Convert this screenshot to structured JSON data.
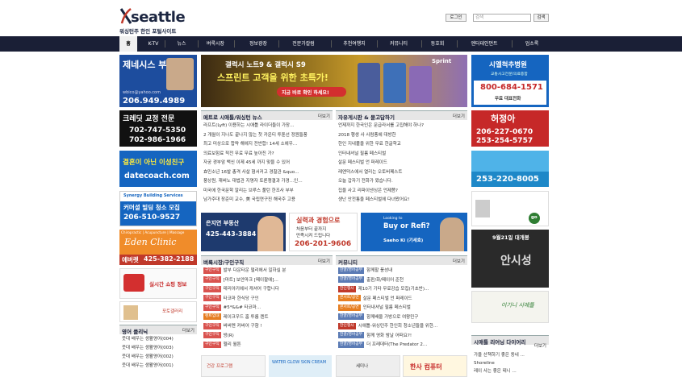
{
  "header": {
    "logo_text": "seattle",
    "logo_sub": "워싱턴주 한인 포털사이트",
    "login_label": "로그인",
    "search_placeholder": "검색",
    "search_button": "검색"
  },
  "nav": {
    "items": [
      {
        "label": "홈"
      },
      {
        "label": "K-TV"
      },
      {
        "label": "뉴스"
      },
      {
        "label": "벼룩시장"
      },
      {
        "label": "정보광장"
      },
      {
        "label": "전문가칼럼"
      },
      {
        "label": "추천여행지"
      },
      {
        "label": "커뮤니티"
      },
      {
        "label": "동호회"
      },
      {
        "label": "엔터테인먼트"
      },
      {
        "label": "업소록"
      }
    ]
  },
  "ads_left": {
    "ad1": {
      "title": "제네시스 부동산",
      "email": "wbico@yahoo.com",
      "phone": "206.949.4989"
    },
    "ad2": {
      "title": "크레딧 교정 전문",
      "phone1": "702-747-5350",
      "phone2": "702-986-1966"
    },
    "ad3": {
      "title": "결혼이 아닌 이성친구",
      "site": "datecoach.com"
    },
    "ad4": {
      "brand": "Synergy Building Services",
      "title": "커머셜 빌딩 청소 모집",
      "phone": "206-510-9527"
    },
    "ad5": {
      "tagline": "Chiropractic | Acupuncture | Massage",
      "name": "Eden Clinic",
      "label": "에버렛",
      "phone": "425-382-2188"
    },
    "ad6": {
      "text": "실시간 쇼핑 정보"
    },
    "ad7": {
      "text": "포토갤러리"
    }
  },
  "banner_main": {
    "brand": "Sprint",
    "headline1": "갤럭시 노트9 & 갤럭시 S9",
    "headline2": "스프린트 고객을 위한 초특가!",
    "cta": "지금 바로 확인 하세요!"
  },
  "ads_right": {
    "ad1": {
      "title": "시엘척추병원",
      "sub": "교통사고전문/의료종합",
      "phone": "800-684-1571",
      "note": "무료 대표전화"
    },
    "ad2": {
      "name": "허정아",
      "phone1": "206-227-0670",
      "phone2": "253-254-5757"
    },
    "ad3": {
      "phone": "253-220-8005"
    },
    "ad4": {
      "badge": "go"
    },
    "ad5": {
      "title": "9월21일 대개봉",
      "movie": "안시성"
    },
    "ad6": {
      "text": "이기니 시애틀"
    }
  },
  "mid_banners": {
    "b1": {
      "name": "은지연 부동산",
      "phone": "425-443-3884"
    },
    "b2": {
      "line1": "실력과 경험으로",
      "line2": "처음부터 끝까지",
      "line3": "만족시켜 드립니다",
      "phone": "206-201-9606"
    },
    "b3": {
      "small": "Looking to",
      "big": "Buy or Refi?",
      "name": "Saeho Ki (기세호)"
    }
  },
  "boards": {
    "news": {
      "title": "메트로 시애틀/워싱턴 뉴스",
      "more": "더보기",
      "items": [
        "라프트(Lyft) 이용하는 시애틀 라이더들이 가장…",
        "2 개월이 지나도 끝나지 않는 첫 카운티 투툰선 정원들풍",
        "최고 미상으로 합략 해에지 전반합! 14세 소에우…",
        "의료보험료 적전 무료 무료 높아진 가?",
        "자궁 경부암 백신 이제 45세 까지 맞을 수 있어",
        "효민소년 16발 총격 사살 혐서커고 경찰관 &quo…",
        "풍상원, 재버노 대법관 지명자 토론쟁결과 가경…인…",
        "미국에 한국문학 알리는 브루스 풀턴 한조사 부부",
        "남가주대 장준미 교수, 美 국립연구진 해국주 고용"
      ]
    },
    "free": {
      "title": "자유게시판 & 묻고답하기",
      "more": "더보기",
      "items": [
        "언제까지 한국인은 문급라서를 고집해야 하나?",
        "2018 행생 사 사람풍에 대방한",
        "한인 지내풀을 위한 무료 한글학교",
        "인터내셔널 필름 페스티벌",
        "살문 페스티벌 언 퍼레이드",
        "레엔덕스에서 열리는 오토버페스트",
        "오늘 갑자기 전화가 왔습니다.",
        "집을 사고 리파이낸싱은 언제쯤?",
        "생난 안전통을 페스티벌에 다녀왔어요!"
      ]
    },
    "flea": {
      "title": "벼룩시장/구인구직",
      "more": "더보기",
      "items": [
        {
          "tag": "구인구직",
          "color": "#d9534f",
          "text": "발부 다운타운 델리에서 일하실 분"
        },
        {
          "tag": "구인구직",
          "color": "#d9534f",
          "text": "[마트] 보안마크 [페이팔에]…"
        },
        {
          "tag": "구인구직",
          "color": "#d9534f",
          "text": "테리야키에서 캐셔어 구합니다"
        },
        {
          "tag": "구인구직",
          "color": "#d9534f",
          "text": "타코마 한식당 구인"
        },
        {
          "tag": "구인구직",
          "color": "#d9534f",
          "text": "#5*&&# 타코마…"
        },
        {
          "tag": "렌트임대",
          "color": "#e67e22",
          "text": "레이크우드 홈 투룸 렌트"
        },
        {
          "tag": "구인구직",
          "color": "#d9534f",
          "text": "버버멘 커버어 구함 !"
        },
        {
          "tag": "구인구직",
          "color": "#d9534f",
          "text": "방(R)"
        },
        {
          "tag": "구인구직",
          "color": "#d9534f",
          "text": "헬리 월튼"
        }
      ]
    },
    "community": {
      "title": "커뮤니티",
      "more": "더보기",
      "items": [
        {
          "tag": "한글/영어공부",
          "color": "#5b7bb5",
          "text": "함께할 풍성내"
        },
        {
          "tag": "한글/영어공부",
          "color": "#5b7bb5",
          "text": "출판/화/페이어 준천"
        },
        {
          "tag": "한인행사",
          "color": "#c0392b",
          "text": "제10기 기타 무료강습 모집(기초반)…"
        },
        {
          "tag": "콘서트/공연",
          "color": "#e67e22",
          "text": "살문 페스티벌 언 퍼레이드"
        },
        {
          "tag": "콘서트/공연",
          "color": "#e67e22",
          "text": "인터내셔널 필름 페스티벌"
        },
        {
          "tag": "한글/영어공부",
          "color": "#5b7bb5",
          "text": "함께배울 가방으로 여왕민구"
        },
        {
          "tag": "한인행사",
          "color": "#c0392b",
          "text": "시애틀-워싱턴주 한인회 청소년들을 위한…"
        },
        {
          "tag": "한글/영어공부",
          "color": "#5b7bb5",
          "text": "함께 영화 밤날 어떠요?!"
        },
        {
          "tag": "한글/영어공부",
          "color": "#5b7bb5",
          "text": "더 프레데터(The Predator 2…"
        }
      ]
    },
    "clinic": {
      "title": "영어 클리닉",
      "more": "더보기",
      "items": [
        "웃대 배우는 생활영어(004)",
        "웃대 배우는 생활영어(003)",
        "웃대 배우는 생활영어(002)",
        "웃대 배우는 생활영어(001)"
      ]
    },
    "review": {
      "title": "시애틀 리어닝 다이어리",
      "more": "더보기",
      "items": [
        "가을 산책하기 좋은 동네 ...",
        "Shoreline",
        "레이 사는 좋은 테니 ..."
      ]
    }
  },
  "bottom_ads": {
    "a1": {
      "text": "건강 프로그램"
    },
    "a2": {
      "text": "WATER GLOW SKIN CREAM"
    },
    "a3": {
      "text": "세미나"
    },
    "a4": {
      "text": "한사 컴퓨터"
    }
  },
  "colors": {
    "nav_bg": "#1a1f36",
    "accent_red": "#d9534f",
    "board_head": "#e6e6e6"
  }
}
